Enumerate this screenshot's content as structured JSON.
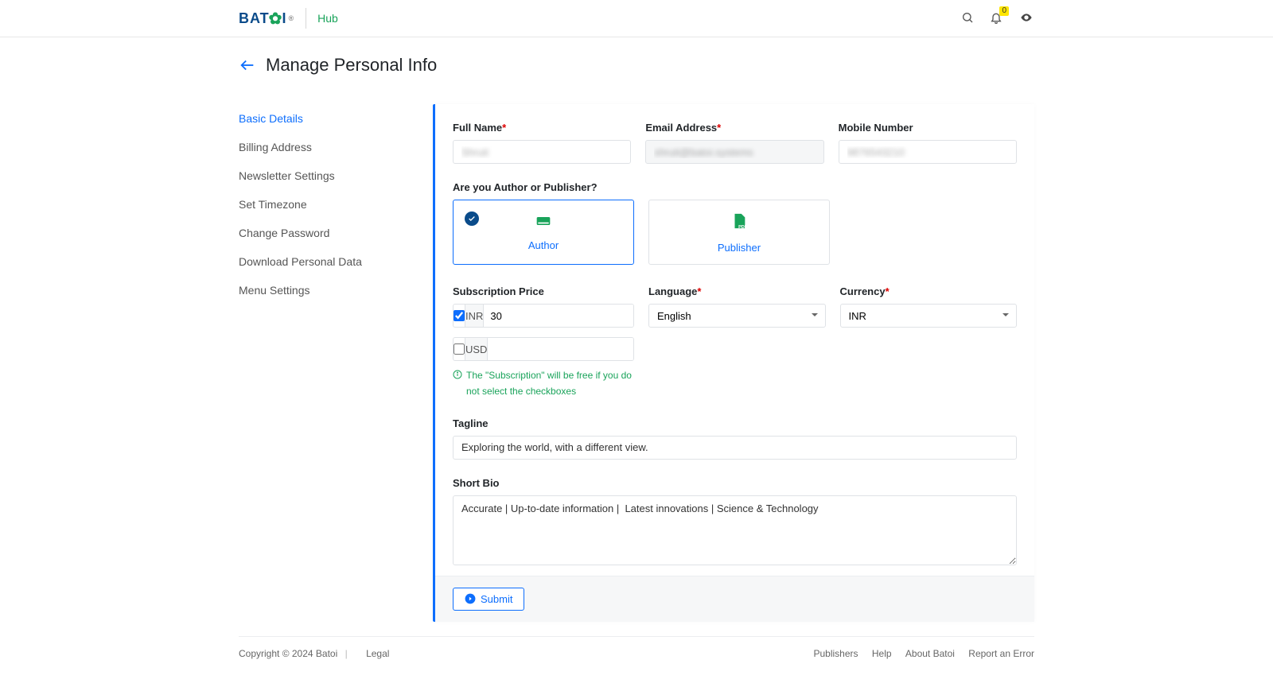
{
  "header": {
    "logo_text_1": "BAT",
    "logo_text_2": "I",
    "hub_label": "Hub",
    "notification_count": "0"
  },
  "page": {
    "title": "Manage Personal Info"
  },
  "sidebar": {
    "items": [
      "Basic Details",
      "Billing Address",
      "Newsletter Settings",
      "Set Timezone",
      "Change Password",
      "Download Personal Data",
      "Menu Settings"
    ],
    "active_index": 0
  },
  "form": {
    "full_name": {
      "label": "Full Name",
      "value": "Shruti"
    },
    "email": {
      "label": "Email Address",
      "value": "shruti@batoi.systems"
    },
    "mobile": {
      "label": "Mobile Number",
      "value": "9876543210"
    },
    "role": {
      "label": "Are you Author or Publisher?",
      "options": [
        {
          "key": "author",
          "label": "Author"
        },
        {
          "key": "publisher",
          "label": "Publisher"
        }
      ],
      "selected": "author"
    },
    "subscription": {
      "label": "Subscription Price",
      "rows": [
        {
          "currency": "INR",
          "checked": true,
          "value": "30"
        },
        {
          "currency": "USD",
          "checked": false,
          "value": ""
        }
      ],
      "hint": "The \"Subscription\" will be free if you do not select the checkboxes"
    },
    "language": {
      "label": "Language",
      "value": "English"
    },
    "currency": {
      "label": "Currency",
      "value": "INR"
    },
    "tagline": {
      "label": "Tagline",
      "value": "Exploring the world, with a different view."
    },
    "bio": {
      "label": "Short Bio",
      "value": "Accurate | Up-to-date information |  Latest innovations | Science & Technology"
    },
    "submit_label": "Submit"
  },
  "footer": {
    "copyright": "Copyright © 2024 Batoi",
    "legal": "Legal",
    "links": [
      "Publishers",
      "Help",
      "About Batoi",
      "Report an Error"
    ]
  }
}
